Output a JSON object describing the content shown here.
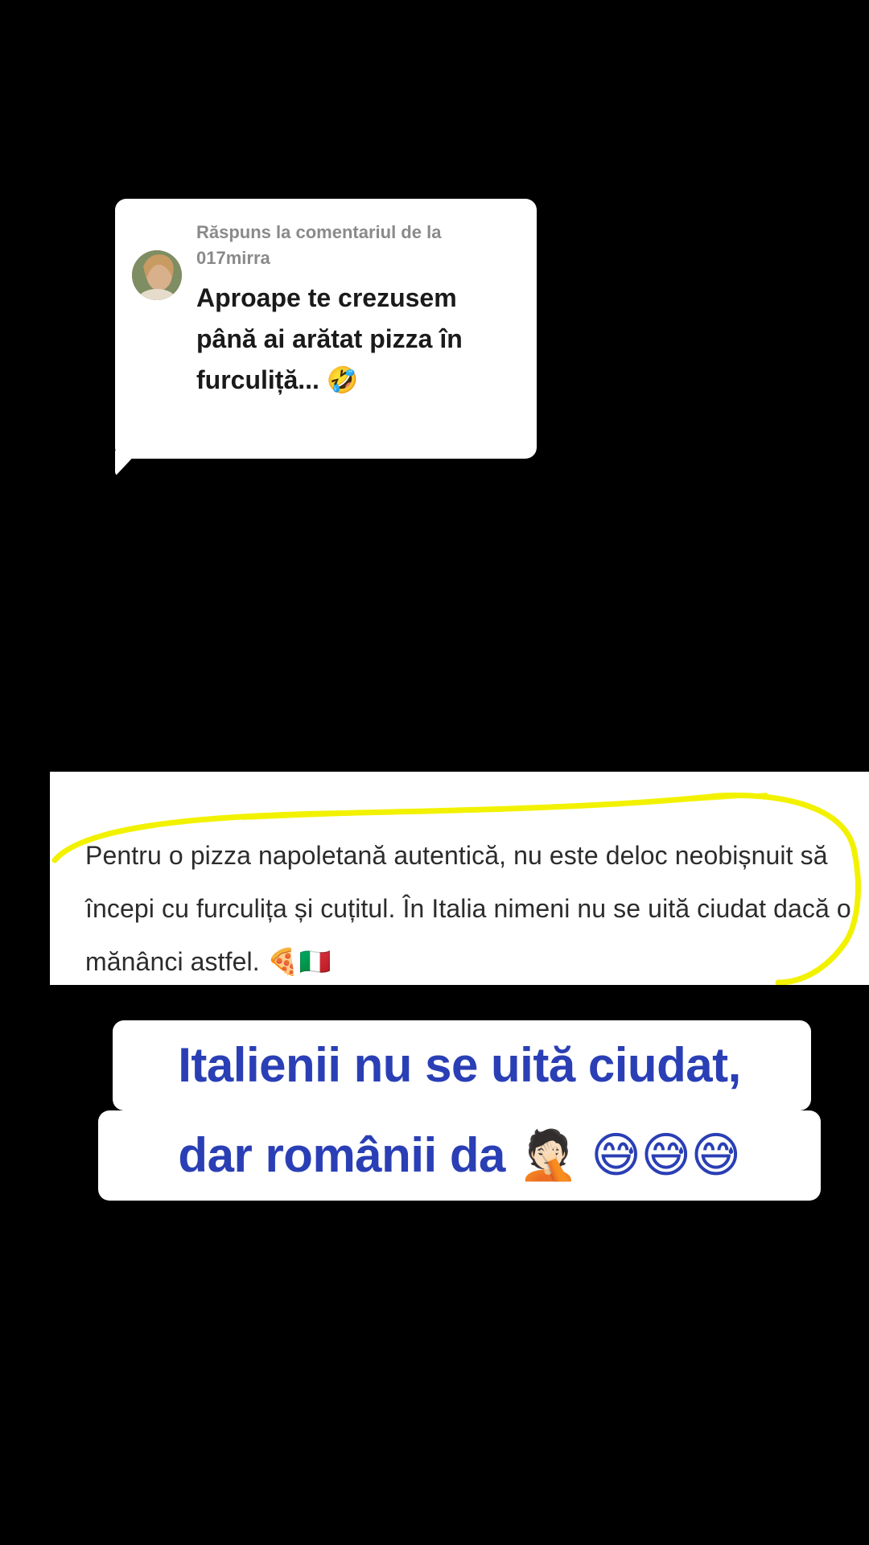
{
  "reply": {
    "meta_label": "Răspuns la comentariul de la 017mirra",
    "comment_text": "Aproape te crezusem până ai arătat pizza în furculiță... 🤣"
  },
  "excerpt": {
    "text": "Pentru o pizza napoletană autentică, nu este deloc neobișnuit să începi cu furculița și cuțitul. În Italia nimeni nu se uită ciudat dacă o mănânci astfel. 🍕🇮🇹",
    "highlight_color": "#f2f200"
  },
  "caption": {
    "line1": "Italienii nu se uită ciudat,",
    "line2": "dar românii da 🤦🏻 😅😅😅",
    "color": "#2a3fb5"
  },
  "icons": {
    "avatar": "user-avatar-photo"
  }
}
